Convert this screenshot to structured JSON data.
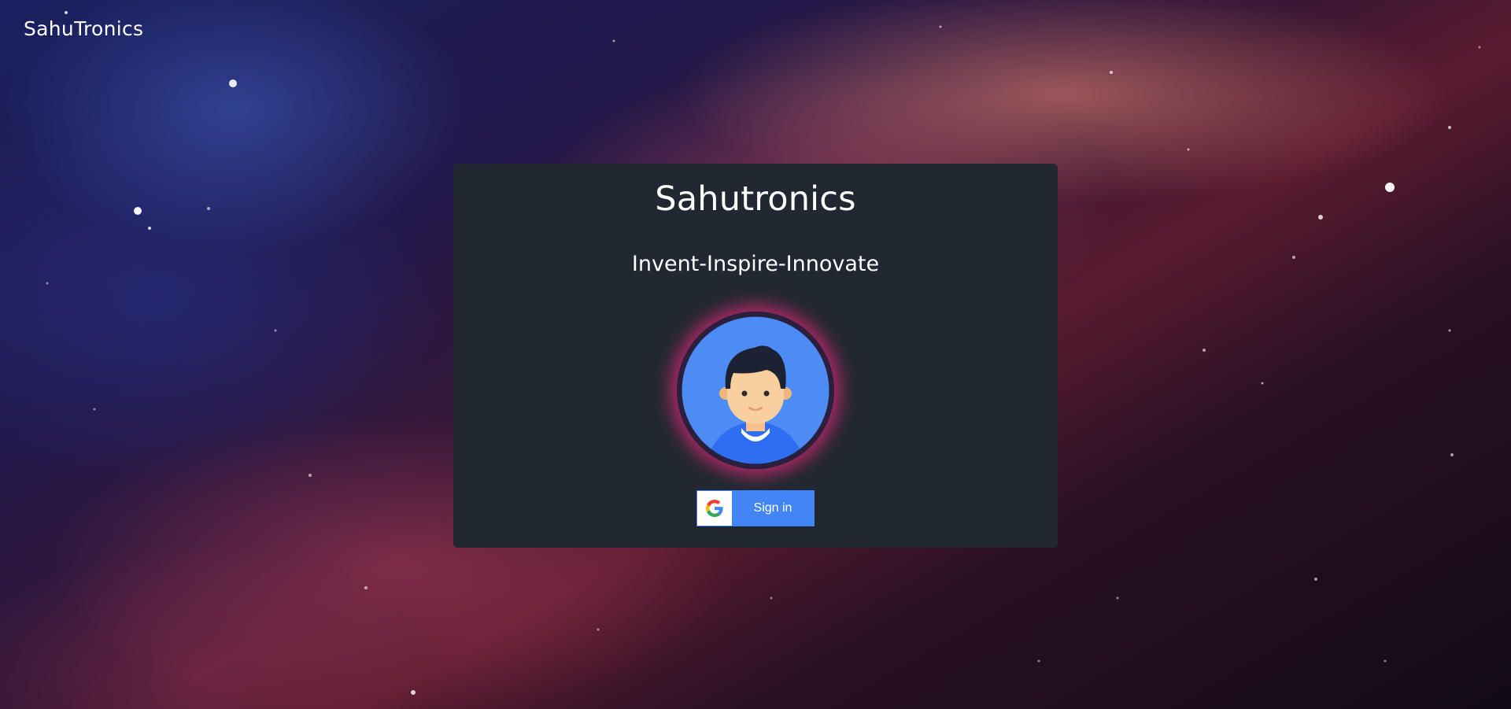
{
  "navbar": {
    "brand": "SahuTronics"
  },
  "card": {
    "title": "Sahutronics",
    "tagline": "Invent-Inspire-Innovate",
    "avatar_icon": "user-avatar-icon",
    "avatar_glow_color": "#e22878",
    "background_color": "#222831"
  },
  "signin_button": {
    "label": "Sign in",
    "icon": "google-g-icon",
    "color": "#4285f4"
  }
}
